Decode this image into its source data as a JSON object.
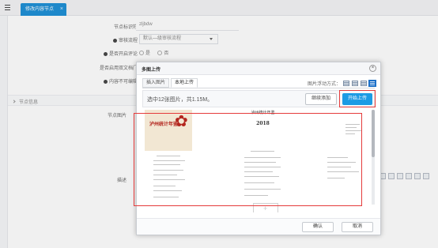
{
  "top_tab": {
    "label": "修改内容节点"
  },
  "form": {
    "node_id_label": "节点标识符",
    "node_id_value": "zljbdw",
    "review_flow_label": "审核流程",
    "review_flow_value": "默认—级审核流程",
    "enable_comment_label": "是否开启评论",
    "enable_comment_options": [
      "是",
      "否"
    ],
    "enable_doc_label": "是否启用双文档门",
    "content_locked_label": "内容不可编辑",
    "section_title": "节点信息",
    "node_image_label": "节点图片",
    "description_label": "描述"
  },
  "modal": {
    "title": "多图上传",
    "tabs": [
      "插入图片",
      "本地上传"
    ],
    "active_tab": "本地上传",
    "display_mode_label": "图片浮动方式：",
    "display_mode_icons": [
      "float-none-icon",
      "float-left-icon",
      "float-right-icon",
      "float-center-icon"
    ],
    "upload_summary": "选中12张图片，共1.15M。",
    "continue_button": "继续添加",
    "start_button": "开始上传",
    "thumb_texts": {
      "cover_title": "泸州统计年鉴",
      "page_heading": "泸州统计年鉴",
      "page_year": "2018"
    },
    "ok_button": "确认",
    "cancel_button": "取消"
  },
  "colors": {
    "accent": "#1c9be4",
    "tab_blue": "#1c8fd6",
    "highlight_red": "#e53b3b"
  }
}
